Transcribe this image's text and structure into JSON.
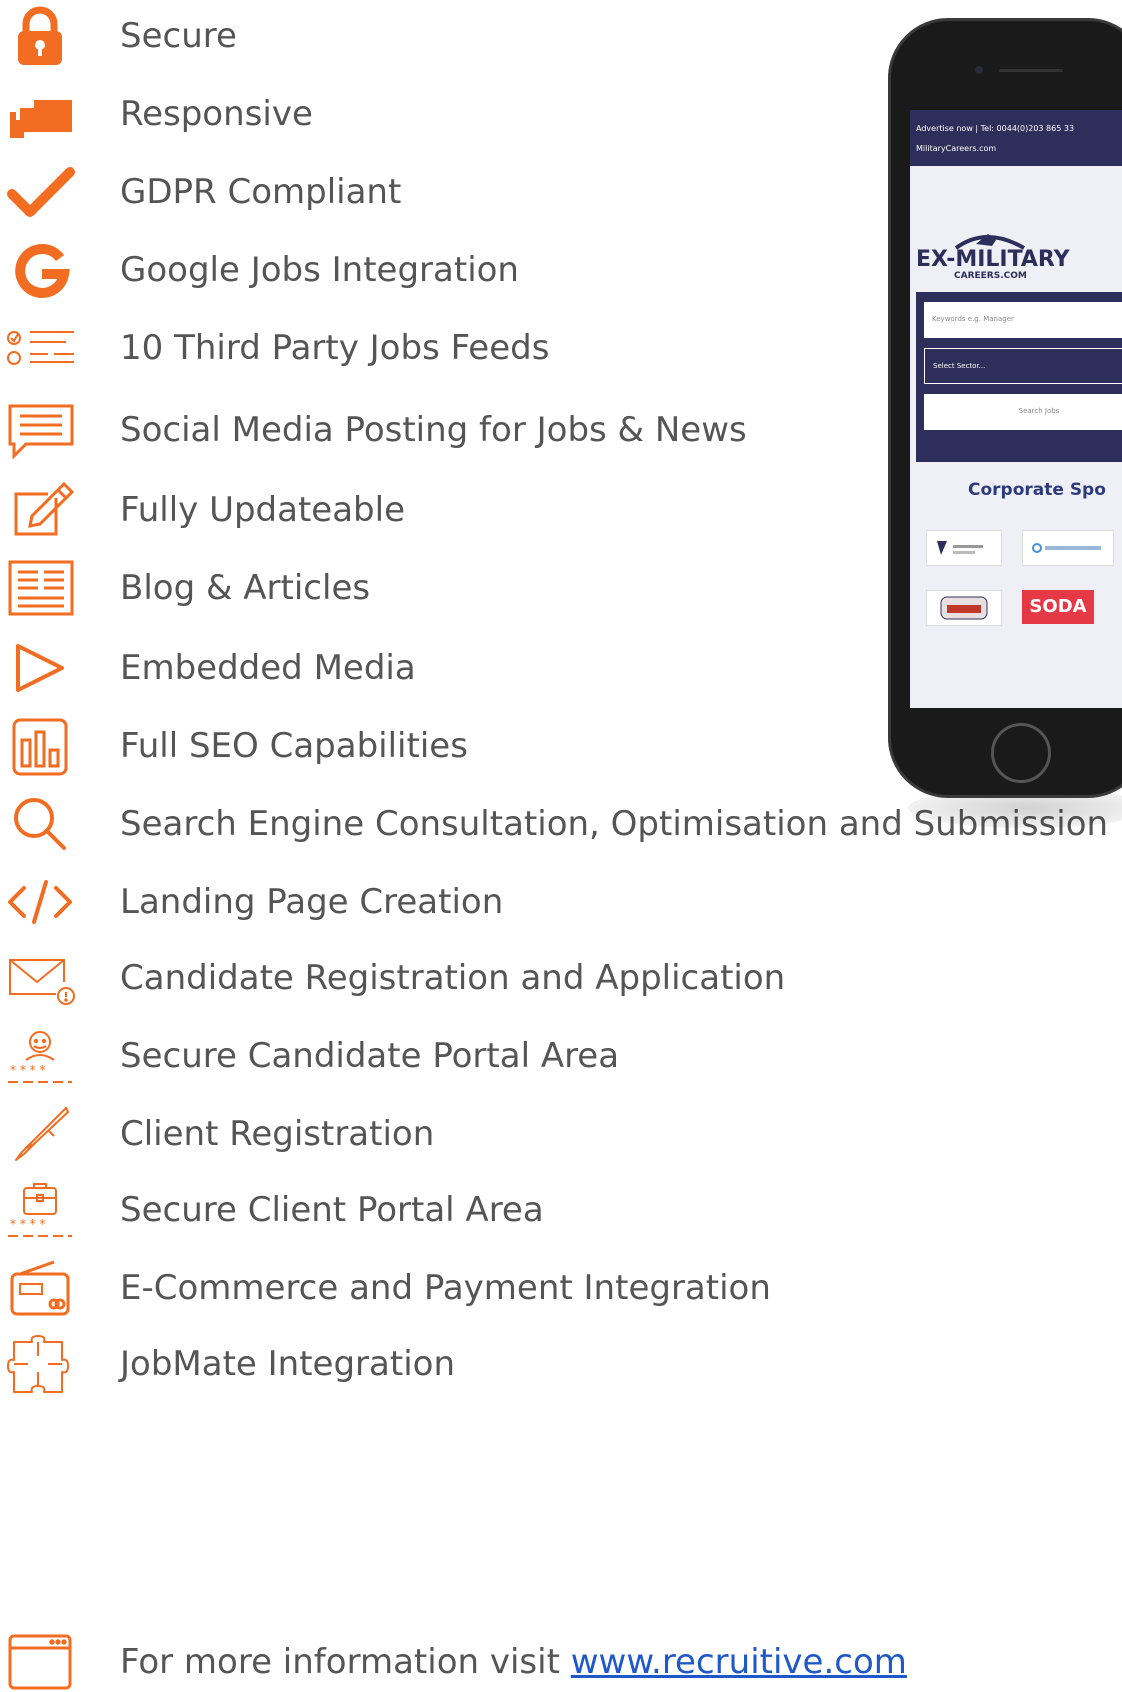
{
  "features": [
    {
      "label": "Secure",
      "icon": "padlock-icon"
    },
    {
      "label": "Responsive",
      "icon": "responsive-devices-icon"
    },
    {
      "label": "GDPR Compliant",
      "icon": "checkmark-icon"
    },
    {
      "label": "Google Jobs Integration",
      "icon": "google-g-icon"
    },
    {
      "label": "10 Third Party Jobs Feeds",
      "icon": "checklist-icon"
    },
    {
      "label": "Social Media Posting for Jobs & News",
      "icon": "speech-bubble-icon"
    },
    {
      "label": "Fully Updateable",
      "icon": "edit-pencil-icon"
    },
    {
      "label": "Blog & Articles",
      "icon": "article-icon"
    },
    {
      "label": "Embedded Media",
      "icon": "play-icon"
    },
    {
      "label": "Full SEO Capabilities",
      "icon": "bar-chart-icon"
    },
    {
      "label": "Search Engine Consultation, Optimisation and Submission",
      "icon": "magnifier-icon"
    },
    {
      "label": "Landing Page Creation",
      "icon": "code-brackets-icon"
    },
    {
      "label": "Candidate Registration and Application",
      "icon": "envelope-alert-icon"
    },
    {
      "label": "Secure Candidate Portal Area",
      "icon": "user-password-icon"
    },
    {
      "label": "Client Registration",
      "icon": "fountain-pen-icon"
    },
    {
      "label": "Secure Client Portal Area",
      "icon": "briefcase-password-icon"
    },
    {
      "label": "E-Commerce and Payment Integration",
      "icon": "payment-card-icon"
    },
    {
      "label": "JobMate Integration",
      "icon": "puzzle-icon"
    }
  ],
  "footer": {
    "text": "For more information visit ",
    "link": "www.recruitive.com",
    "icon": "browser-window-icon"
  },
  "phone": {
    "topbar_line1": "Advertise now | Tel: 0044(0)203 865 33",
    "topbar_line2": "MilitaryCareers.com",
    "logo_text": "EX-MILITARY",
    "logo_sub": "CAREERS.COM",
    "keywords_placeholder": "Keywords e.g. Manager",
    "sector_placeholder": "Select Sector...",
    "search_button": "Search Jobs",
    "corporate_heading": "Corporate Spo",
    "sponsor_logo": "SODA"
  },
  "colors": {
    "accent": "#f26c21",
    "text": "#555555",
    "link": "#1f58c8",
    "navy": "#2d2e5a"
  }
}
